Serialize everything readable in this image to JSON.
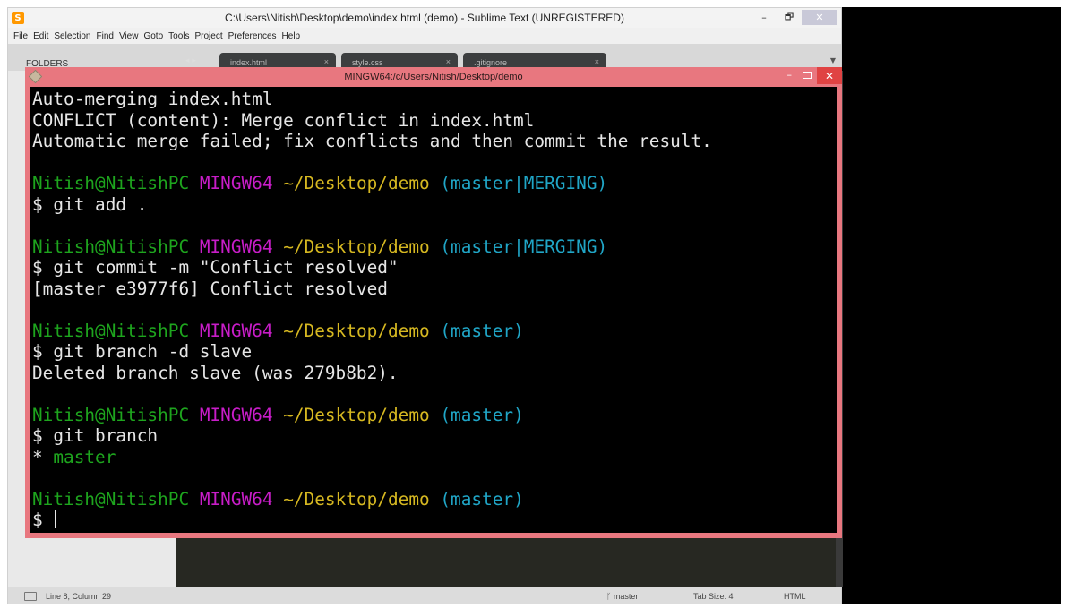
{
  "sublime": {
    "title": "C:\\Users\\Nitish\\Desktop\\demo\\index.html (demo) - Sublime Text (UNREGISTERED)",
    "menu": [
      "File",
      "Edit",
      "Selection",
      "Find",
      "View",
      "Goto",
      "Tools",
      "Project",
      "Preferences",
      "Help"
    ],
    "sidebar_header": "FOLDERS",
    "tabs": [
      {
        "label": "index.html",
        "close": "×"
      },
      {
        "label": "style.css",
        "close": "×"
      },
      {
        "label": ".gitignore",
        "close": "×"
      }
    ],
    "tab_nav": "◂ ▸",
    "window_controls": {
      "minimize": "–",
      "maximize": "🗗",
      "close": "✕"
    },
    "status": {
      "position": "Line 8, Column 29",
      "branch": "ᚴ master",
      "tab_size": "Tab Size: 4",
      "syntax": "HTML"
    }
  },
  "terminal": {
    "title": "MINGW64:/c/Users/Nitish/Desktop/demo",
    "controls": {
      "minimize": "–",
      "close": "✕"
    },
    "lines": [
      {
        "parts": [
          {
            "t": "Auto-merging index.html",
            "c": "w"
          }
        ]
      },
      {
        "parts": [
          {
            "t": "CONFLICT (content): Merge conflict in index.html",
            "c": "w"
          }
        ]
      },
      {
        "parts": [
          {
            "t": "Automatic merge failed; fix conflicts and then commit the result.",
            "c": "w"
          }
        ]
      },
      {
        "parts": [
          {
            "t": "",
            "c": "w"
          }
        ]
      },
      {
        "parts": [
          {
            "t": "Nitish@NitishPC",
            "c": "g"
          },
          {
            "t": " ",
            "c": "w"
          },
          {
            "t": "MINGW64",
            "c": "m"
          },
          {
            "t": " ",
            "c": "w"
          },
          {
            "t": "~/Desktop/demo",
            "c": "y"
          },
          {
            "t": " ",
            "c": "w"
          },
          {
            "t": "(master|MERGING)",
            "c": "c"
          }
        ]
      },
      {
        "parts": [
          {
            "t": "$ git add .",
            "c": "w"
          }
        ]
      },
      {
        "parts": [
          {
            "t": "",
            "c": "w"
          }
        ]
      },
      {
        "parts": [
          {
            "t": "Nitish@NitishPC",
            "c": "g"
          },
          {
            "t": " ",
            "c": "w"
          },
          {
            "t": "MINGW64",
            "c": "m"
          },
          {
            "t": " ",
            "c": "w"
          },
          {
            "t": "~/Desktop/demo",
            "c": "y"
          },
          {
            "t": " ",
            "c": "w"
          },
          {
            "t": "(master|MERGING)",
            "c": "c"
          }
        ]
      },
      {
        "parts": [
          {
            "t": "$ git commit -m \"Conflict resolved\"",
            "c": "w"
          }
        ]
      },
      {
        "parts": [
          {
            "t": "[master e3977f6] Conflict resolved",
            "c": "w"
          }
        ]
      },
      {
        "parts": [
          {
            "t": "",
            "c": "w"
          }
        ]
      },
      {
        "parts": [
          {
            "t": "Nitish@NitishPC",
            "c": "g"
          },
          {
            "t": " ",
            "c": "w"
          },
          {
            "t": "MINGW64",
            "c": "m"
          },
          {
            "t": " ",
            "c": "w"
          },
          {
            "t": "~/Desktop/demo",
            "c": "y"
          },
          {
            "t": " ",
            "c": "w"
          },
          {
            "t": "(master)",
            "c": "c"
          }
        ]
      },
      {
        "parts": [
          {
            "t": "$ git branch -d slave",
            "c": "w"
          }
        ]
      },
      {
        "parts": [
          {
            "t": "Deleted branch slave (was 279b8b2).",
            "c": "w"
          }
        ]
      },
      {
        "parts": [
          {
            "t": "",
            "c": "w"
          }
        ]
      },
      {
        "parts": [
          {
            "t": "Nitish@NitishPC",
            "c": "g"
          },
          {
            "t": " ",
            "c": "w"
          },
          {
            "t": "MINGW64",
            "c": "m"
          },
          {
            "t": " ",
            "c": "w"
          },
          {
            "t": "~/Desktop/demo",
            "c": "y"
          },
          {
            "t": " ",
            "c": "w"
          },
          {
            "t": "(master)",
            "c": "c"
          }
        ]
      },
      {
        "parts": [
          {
            "t": "$ git branch",
            "c": "w"
          }
        ]
      },
      {
        "parts": [
          {
            "t": "* ",
            "c": "w"
          },
          {
            "t": "master",
            "c": "g"
          }
        ]
      },
      {
        "parts": [
          {
            "t": "",
            "c": "w"
          }
        ]
      },
      {
        "parts": [
          {
            "t": "Nitish@NitishPC",
            "c": "g"
          },
          {
            "t": " ",
            "c": "w"
          },
          {
            "t": "MINGW64",
            "c": "m"
          },
          {
            "t": " ",
            "c": "w"
          },
          {
            "t": "~/Desktop/demo",
            "c": "y"
          },
          {
            "t": " ",
            "c": "w"
          },
          {
            "t": "(master)",
            "c": "c"
          }
        ]
      }
    ],
    "prompt": "$ ",
    "colors": {
      "border": "#e8777f",
      "user": "#1ea51e",
      "host": "#c81dc8",
      "path": "#d6b821",
      "branch": "#20a6c7"
    }
  }
}
